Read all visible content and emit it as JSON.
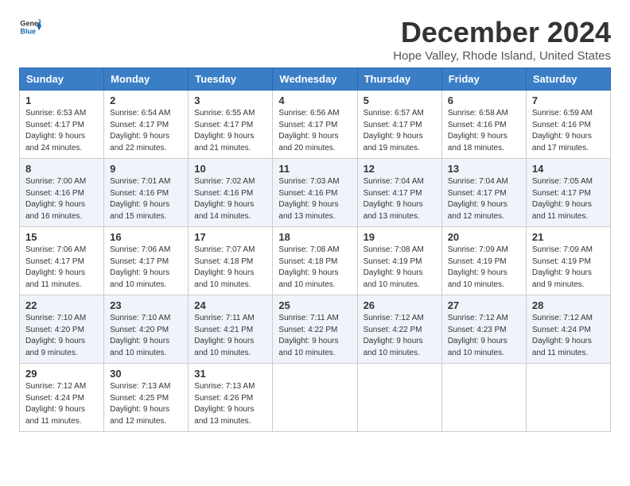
{
  "header": {
    "logo_general": "General",
    "logo_blue": "Blue",
    "month_title": "December 2024",
    "location": "Hope Valley, Rhode Island, United States"
  },
  "days_of_week": [
    "Sunday",
    "Monday",
    "Tuesday",
    "Wednesday",
    "Thursday",
    "Friday",
    "Saturday"
  ],
  "weeks": [
    [
      {
        "day": 1,
        "info": "Sunrise: 6:53 AM\nSunset: 4:17 PM\nDaylight: 9 hours and 24 minutes."
      },
      {
        "day": 2,
        "info": "Sunrise: 6:54 AM\nSunset: 4:17 PM\nDaylight: 9 hours and 22 minutes."
      },
      {
        "day": 3,
        "info": "Sunrise: 6:55 AM\nSunset: 4:17 PM\nDaylight: 9 hours and 21 minutes."
      },
      {
        "day": 4,
        "info": "Sunrise: 6:56 AM\nSunset: 4:17 PM\nDaylight: 9 hours and 20 minutes."
      },
      {
        "day": 5,
        "info": "Sunrise: 6:57 AM\nSunset: 4:17 PM\nDaylight: 9 hours and 19 minutes."
      },
      {
        "day": 6,
        "info": "Sunrise: 6:58 AM\nSunset: 4:16 PM\nDaylight: 9 hours and 18 minutes."
      },
      {
        "day": 7,
        "info": "Sunrise: 6:59 AM\nSunset: 4:16 PM\nDaylight: 9 hours and 17 minutes."
      }
    ],
    [
      {
        "day": 8,
        "info": "Sunrise: 7:00 AM\nSunset: 4:16 PM\nDaylight: 9 hours and 16 minutes."
      },
      {
        "day": 9,
        "info": "Sunrise: 7:01 AM\nSunset: 4:16 PM\nDaylight: 9 hours and 15 minutes."
      },
      {
        "day": 10,
        "info": "Sunrise: 7:02 AM\nSunset: 4:16 PM\nDaylight: 9 hours and 14 minutes."
      },
      {
        "day": 11,
        "info": "Sunrise: 7:03 AM\nSunset: 4:16 PM\nDaylight: 9 hours and 13 minutes."
      },
      {
        "day": 12,
        "info": "Sunrise: 7:04 AM\nSunset: 4:17 PM\nDaylight: 9 hours and 13 minutes."
      },
      {
        "day": 13,
        "info": "Sunrise: 7:04 AM\nSunset: 4:17 PM\nDaylight: 9 hours and 12 minutes."
      },
      {
        "day": 14,
        "info": "Sunrise: 7:05 AM\nSunset: 4:17 PM\nDaylight: 9 hours and 11 minutes."
      }
    ],
    [
      {
        "day": 15,
        "info": "Sunrise: 7:06 AM\nSunset: 4:17 PM\nDaylight: 9 hours and 11 minutes."
      },
      {
        "day": 16,
        "info": "Sunrise: 7:06 AM\nSunset: 4:17 PM\nDaylight: 9 hours and 10 minutes."
      },
      {
        "day": 17,
        "info": "Sunrise: 7:07 AM\nSunset: 4:18 PM\nDaylight: 9 hours and 10 minutes."
      },
      {
        "day": 18,
        "info": "Sunrise: 7:08 AM\nSunset: 4:18 PM\nDaylight: 9 hours and 10 minutes."
      },
      {
        "day": 19,
        "info": "Sunrise: 7:08 AM\nSunset: 4:19 PM\nDaylight: 9 hours and 10 minutes."
      },
      {
        "day": 20,
        "info": "Sunrise: 7:09 AM\nSunset: 4:19 PM\nDaylight: 9 hours and 10 minutes."
      },
      {
        "day": 21,
        "info": "Sunrise: 7:09 AM\nSunset: 4:19 PM\nDaylight: 9 hours and 9 minutes."
      }
    ],
    [
      {
        "day": 22,
        "info": "Sunrise: 7:10 AM\nSunset: 4:20 PM\nDaylight: 9 hours and 9 minutes."
      },
      {
        "day": 23,
        "info": "Sunrise: 7:10 AM\nSunset: 4:20 PM\nDaylight: 9 hours and 10 minutes."
      },
      {
        "day": 24,
        "info": "Sunrise: 7:11 AM\nSunset: 4:21 PM\nDaylight: 9 hours and 10 minutes."
      },
      {
        "day": 25,
        "info": "Sunrise: 7:11 AM\nSunset: 4:22 PM\nDaylight: 9 hours and 10 minutes."
      },
      {
        "day": 26,
        "info": "Sunrise: 7:12 AM\nSunset: 4:22 PM\nDaylight: 9 hours and 10 minutes."
      },
      {
        "day": 27,
        "info": "Sunrise: 7:12 AM\nSunset: 4:23 PM\nDaylight: 9 hours and 10 minutes."
      },
      {
        "day": 28,
        "info": "Sunrise: 7:12 AM\nSunset: 4:24 PM\nDaylight: 9 hours and 11 minutes."
      }
    ],
    [
      {
        "day": 29,
        "info": "Sunrise: 7:12 AM\nSunset: 4:24 PM\nDaylight: 9 hours and 11 minutes."
      },
      {
        "day": 30,
        "info": "Sunrise: 7:13 AM\nSunset: 4:25 PM\nDaylight: 9 hours and 12 minutes."
      },
      {
        "day": 31,
        "info": "Sunrise: 7:13 AM\nSunset: 4:26 PM\nDaylight: 9 hours and 13 minutes."
      },
      null,
      null,
      null,
      null
    ]
  ]
}
